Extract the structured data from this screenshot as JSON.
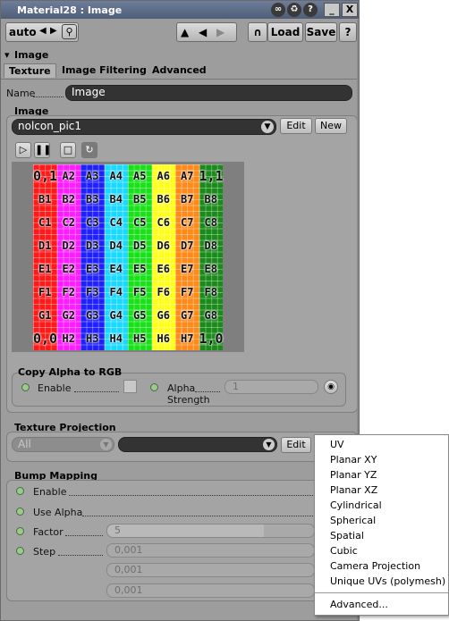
{
  "window": {
    "title": "Material28 : Image"
  },
  "toolbar": {
    "auto_label": "auto",
    "load_label": "Load",
    "save_label": "Save"
  },
  "section": {
    "title": "Image"
  },
  "tabs": [
    {
      "label": "Texture"
    },
    {
      "label": "Image Filtering"
    },
    {
      "label": "Advanced"
    }
  ],
  "name_field": {
    "label": "Name",
    "value": "Image"
  },
  "image_group": {
    "title": "Image",
    "selected": "nolcon_pic1",
    "edit_label": "Edit",
    "new_label": "New"
  },
  "texture_grid": {
    "rows": [
      [
        "0,1",
        "A2",
        "A3",
        "A4",
        "A5",
        "A6",
        "A7",
        "1,1"
      ],
      [
        "B1",
        "B2",
        "B3",
        "B4",
        "B5",
        "B6",
        "B7",
        "B8"
      ],
      [
        "C1",
        "C2",
        "C3",
        "C4",
        "C5",
        "C6",
        "C7",
        "C8"
      ],
      [
        "D1",
        "D2",
        "D3",
        "D4",
        "D5",
        "D6",
        "D7",
        "D8"
      ],
      [
        "E1",
        "E2",
        "E3",
        "E4",
        "E5",
        "E6",
        "E7",
        "E8"
      ],
      [
        "F1",
        "F2",
        "F3",
        "F4",
        "F5",
        "F6",
        "F7",
        "F8"
      ],
      [
        "G1",
        "G2",
        "G3",
        "G4",
        "G5",
        "G6",
        "G7",
        "G8"
      ],
      [
        "0,0",
        "H2",
        "H3",
        "H4",
        "H5",
        "H6",
        "H7",
        "1,0"
      ]
    ],
    "column_colors": [
      "#ff1a1a",
      "#ff1aff",
      "#2020ff",
      "#1ad8ff",
      "#1ae01a",
      "#ffff1a",
      "#ff8a1a",
      "#1a8a1a"
    ]
  },
  "copy_alpha": {
    "title": "Copy Alpha to RGB",
    "enable_label": "Enable",
    "alpha_label": "Alpha",
    "strength_label": "Strength",
    "strength_value": "1"
  },
  "texture_projection": {
    "title": "Texture Projection",
    "uv_set": "All",
    "edit_label": "Edit"
  },
  "bump_mapping": {
    "title": "Bump Mapping",
    "enable_label": "Enable",
    "use_alpha_label": "Use Alpha",
    "factor_label": "Factor",
    "factor_value": "5",
    "step_label": "Step",
    "step_values": [
      "0,001",
      "0,001",
      "0,001"
    ]
  },
  "projection_menu": {
    "items": [
      "UV",
      "Planar XY",
      "Planar YZ",
      "Planar XZ",
      "Cylindrical",
      "Spherical",
      "Spatial",
      "Cubic",
      "Camera Projection",
      "Unique UVs (polymesh)"
    ],
    "advanced": "Advanced..."
  }
}
